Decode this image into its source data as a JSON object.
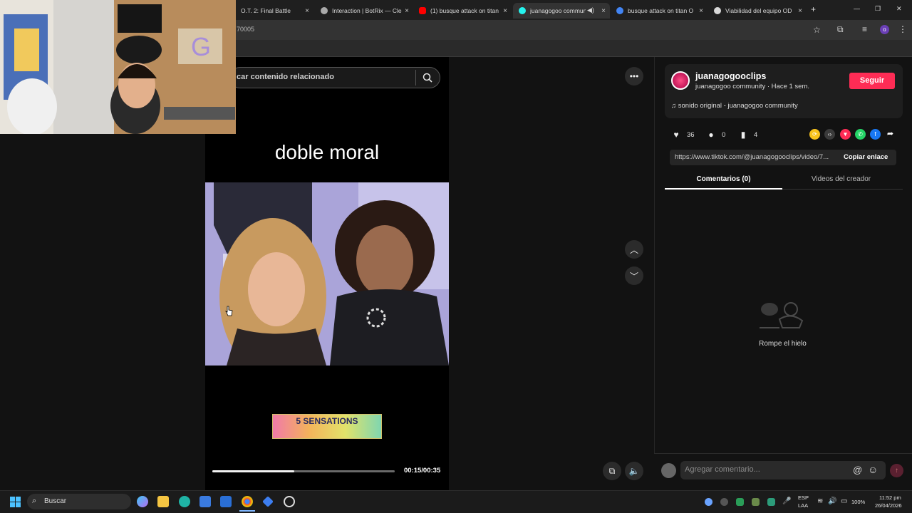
{
  "browser": {
    "tabs": [
      {
        "title": "O.T. 2: Final Battle",
        "color": "#4e7ad8"
      },
      {
        "title": "Interaction | BotRix — Cle",
        "color": "#aaaaaa"
      },
      {
        "title": "(1) busque attack on titan",
        "color": "#ff0000"
      },
      {
        "title": "juanagogoo commun",
        "color": "#25f4ee"
      },
      {
        "title": "busque attack on titan O",
        "color": "#4285f4"
      },
      {
        "title": "Viabilidad del equipo OD",
        "color": "#d8d8d8"
      }
    ],
    "url": "70005",
    "new_tab": "+",
    "close": "×",
    "window_min": "—",
    "window_max": "❐",
    "window_close": "✕"
  },
  "search": {
    "placeholder": "car contenido relacionado"
  },
  "video": {
    "caption": "doble moral",
    "banner": "5 SENSATIONS",
    "time": "00:15/00:35",
    "progress": 0.45
  },
  "creator": {
    "username": "juanagogooclips",
    "subline": "juanagogoo community · Hace 1 sem.",
    "follow_label": "Seguir",
    "music": "sonido original - juanagogoo community"
  },
  "stats": {
    "likes": "36",
    "comments": "0",
    "saves": "4"
  },
  "link": {
    "url": "https://www.tiktok.com/@juanagogooclips/video/7...",
    "copy_label": "Copiar enlace"
  },
  "tabs": {
    "comments": "Comentarios (0)",
    "videos": "Videos del creador"
  },
  "empty_state": "Rompe el hielo",
  "comment_input": {
    "placeholder": "Agregar comentario..."
  },
  "taskbar": {
    "search_label": "Buscar",
    "lang_1": "ESP",
    "lang_2": "LAA",
    "battery": "100%",
    "time": "11:52 pm",
    "date": "26/04/2026"
  },
  "colors": {
    "follow": "#fe2c55",
    "background": "#121212"
  }
}
